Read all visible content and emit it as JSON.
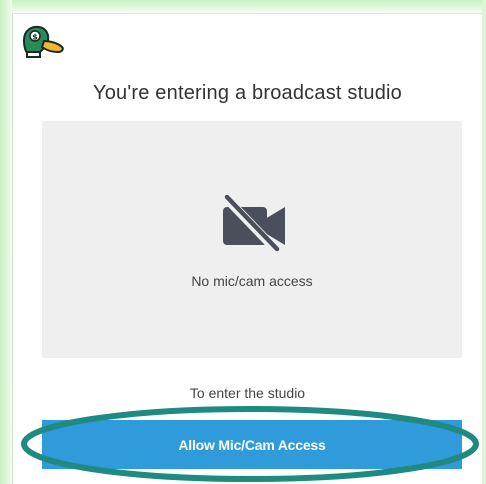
{
  "studio": {
    "title": "You're entering a broadcast studio",
    "preview_status": "No mic/cam access",
    "enter_prompt": "To enter the studio",
    "allow_button_label": "Allow Mic/Cam Access"
  },
  "icons": {
    "logo": "duck-logo-icon",
    "camera": "camera-off-icon"
  },
  "colors": {
    "button": "#2f9bdb",
    "preview_bg": "#efefef",
    "camera_icon": "#4a4f5b",
    "highlight_ring": "#1f8a82",
    "frame_green": "#c9f2c2"
  }
}
